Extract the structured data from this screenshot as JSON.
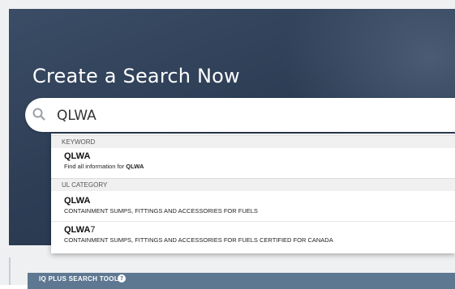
{
  "hero": {
    "title": "Create a Search Now"
  },
  "search": {
    "value": "QLWA",
    "icon": "search-icon"
  },
  "suggestions": {
    "groups": [
      {
        "header": "KEYWORD",
        "items": [
          {
            "title_match": "QLWA",
            "title_rest": "",
            "desc_prefix": "Find all information for ",
            "desc_bold": "QLWA"
          }
        ]
      },
      {
        "header": "UL CATEGORY",
        "items": [
          {
            "title_match": "QLWA",
            "title_rest": "",
            "desc_prefix": "CONTAINMENT SUMPS, FITTINGS AND ACCESSORIES FOR FUELS",
            "desc_bold": ""
          },
          {
            "title_match": "QLWA",
            "title_rest": "7",
            "desc_prefix": "CONTAINMENT SUMPS, FITTINGS AND ACCESSORIES FOR FUELS CERTIFIED FOR CANADA",
            "desc_bold": ""
          }
        ]
      }
    ]
  },
  "tools": {
    "label": "IQ PLUS SEARCH TOOLS",
    "help_icon": "help-circle-icon",
    "help_glyph": "?"
  },
  "colors": {
    "hero_bg": "#2d3e55",
    "tools_bar": "#5e7891"
  }
}
